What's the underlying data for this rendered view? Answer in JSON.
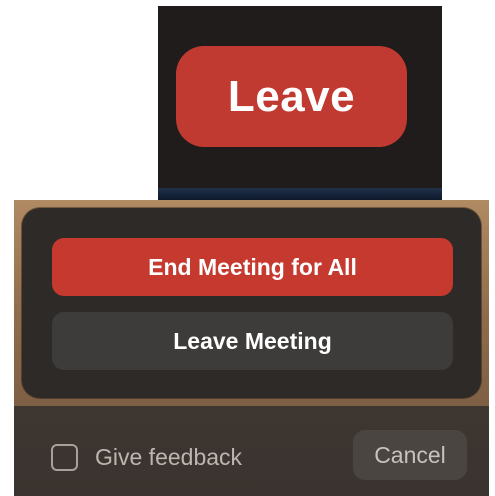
{
  "toolbar": {
    "leave_label": "Leave"
  },
  "dialog": {
    "end_all_label": "End Meeting for All",
    "leave_meeting_label": "Leave Meeting",
    "feedback_label": "Give feedback",
    "feedback_checked": false,
    "cancel_label": "Cancel"
  },
  "colors": {
    "danger_red": "#c5392f",
    "neutral_button": "#3e3c3a",
    "popover_bg": "#2d2a28",
    "toolbar_bg": "#1f1c1b"
  }
}
